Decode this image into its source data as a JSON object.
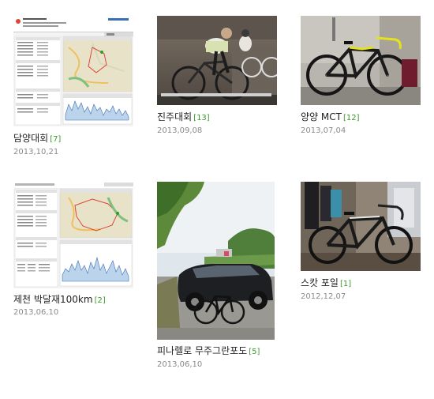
{
  "posts": [
    {
      "title": "담양대회",
      "count": "[7]",
      "date": "2013,10,21",
      "thumb": "gps-map-screenshot"
    },
    {
      "title": "진주대회",
      "count": "[13]",
      "date": "2013,09,08",
      "thumb": "cyclists-on-rollers-photo"
    },
    {
      "title": "양양 MCT",
      "count": "[12]",
      "date": "2013,07,04",
      "thumb": "road-bike-photo"
    },
    {
      "title": "제천 박달재100km",
      "count": "[2]",
      "date": "2013,06,10",
      "thumb": "gps-map-screenshot"
    },
    {
      "title": "피나렐로 무주그란포도",
      "count": "[5]",
      "date": "2013,06,10",
      "thumb": "car-and-bike-photo"
    },
    {
      "title": "스캇 포일",
      "count": "[1]",
      "date": "2012,12,07",
      "thumb": "road-bike-indoor-photo"
    }
  ]
}
